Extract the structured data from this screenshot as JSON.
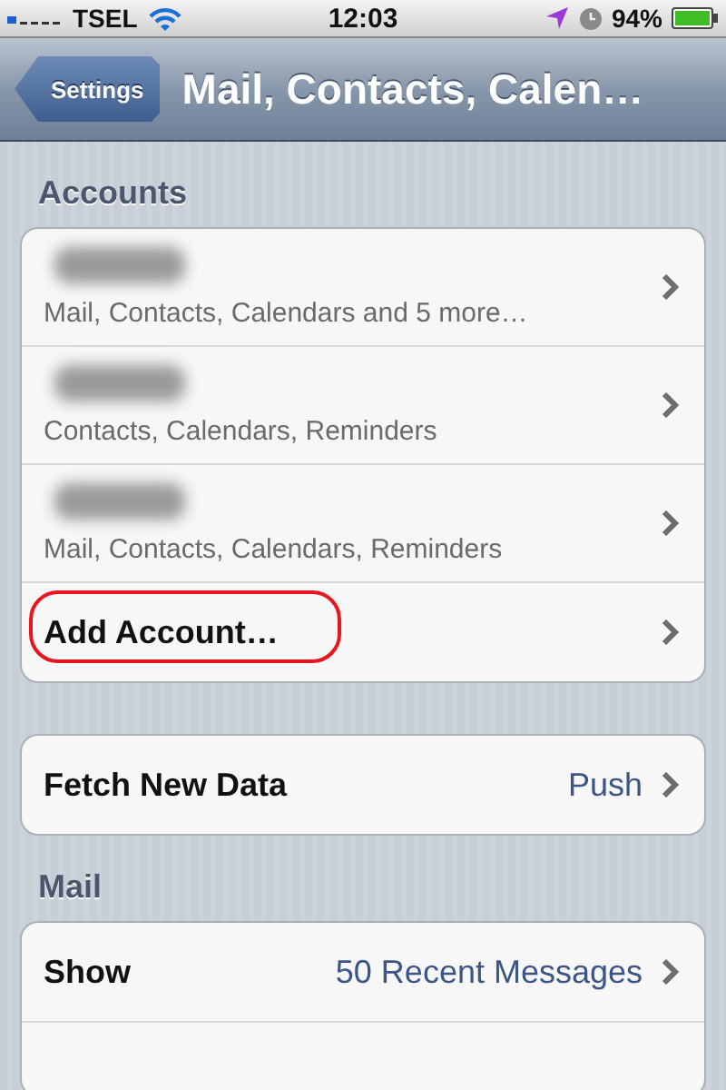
{
  "status_bar": {
    "carrier": "TSEL",
    "time": "12:03",
    "battery": "94%"
  },
  "nav_bar": {
    "back": "Settings",
    "title": "Mail, Contacts, Calen…"
  },
  "sections": [
    {
      "header": "Accounts",
      "rows": [
        {
          "kind": "account",
          "detail": "Mail, Contacts, Calendars and 5 more…",
          "highlighted": false
        },
        {
          "kind": "account",
          "detail": "Contacts, Calendars, Reminders",
          "highlighted": false
        },
        {
          "kind": "account",
          "detail": "Mail, Contacts, Calendars, Reminders",
          "highlighted": false
        },
        {
          "kind": "plain",
          "label": "Add Account…",
          "highlighted": true
        }
      ]
    },
    {
      "rows": [
        {
          "kind": "value",
          "label": "Fetch New Data",
          "value": "Push",
          "highlighted": false
        }
      ]
    },
    {
      "header": "Mail",
      "rows": [
        {
          "kind": "value",
          "label": "Show",
          "value": "50 Recent Messages",
          "highlighted": false
        },
        {
          "kind": "empty",
          "highlighted": false
        }
      ]
    }
  ]
}
